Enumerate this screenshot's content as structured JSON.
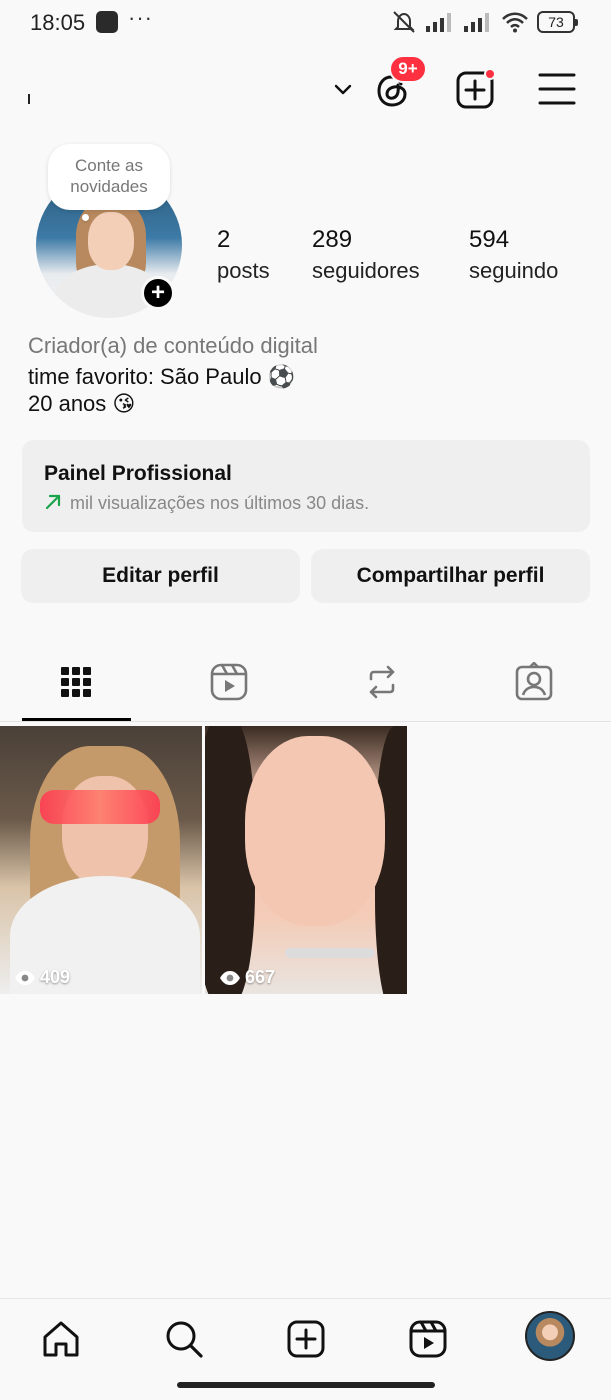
{
  "status_bar": {
    "time": "18:05",
    "dots": "···",
    "battery": "73"
  },
  "header": {
    "username": "",
    "notification_badge": "9+"
  },
  "profile": {
    "note": "Conte as novidades",
    "stats": [
      {
        "value": "2",
        "label": "posts"
      },
      {
        "value": "289",
        "label": "seguidores"
      },
      {
        "value": "594",
        "label": "seguindo"
      }
    ],
    "category": "Criador(a) de conteúdo digital",
    "bio_lines": [
      "time favorito: São Paulo ⚽",
      "20 anos 😘"
    ]
  },
  "professional_panel": {
    "title": "Painel Profissional",
    "subtitle": "mil visualizações nos últimos 30 dias."
  },
  "buttons": {
    "edit": "Editar perfil",
    "share": "Compartilhar perfil"
  },
  "tabs": [
    {
      "icon": "grid-icon",
      "active": true
    },
    {
      "icon": "reels-icon",
      "active": false
    },
    {
      "icon": "reposts-icon",
      "active": false
    },
    {
      "icon": "tagged-icon",
      "active": false
    }
  ],
  "posts": [
    {
      "views": "409"
    },
    {
      "views": "667"
    }
  ],
  "bottom_nav": [
    "home-icon",
    "search-icon",
    "create-icon",
    "reels-icon",
    "profile-avatar"
  ],
  "colors": {
    "badge": "#ff3040",
    "background": "#f9f9f9",
    "panel": "#efefef",
    "trend_arrow": "#1aa34a"
  }
}
